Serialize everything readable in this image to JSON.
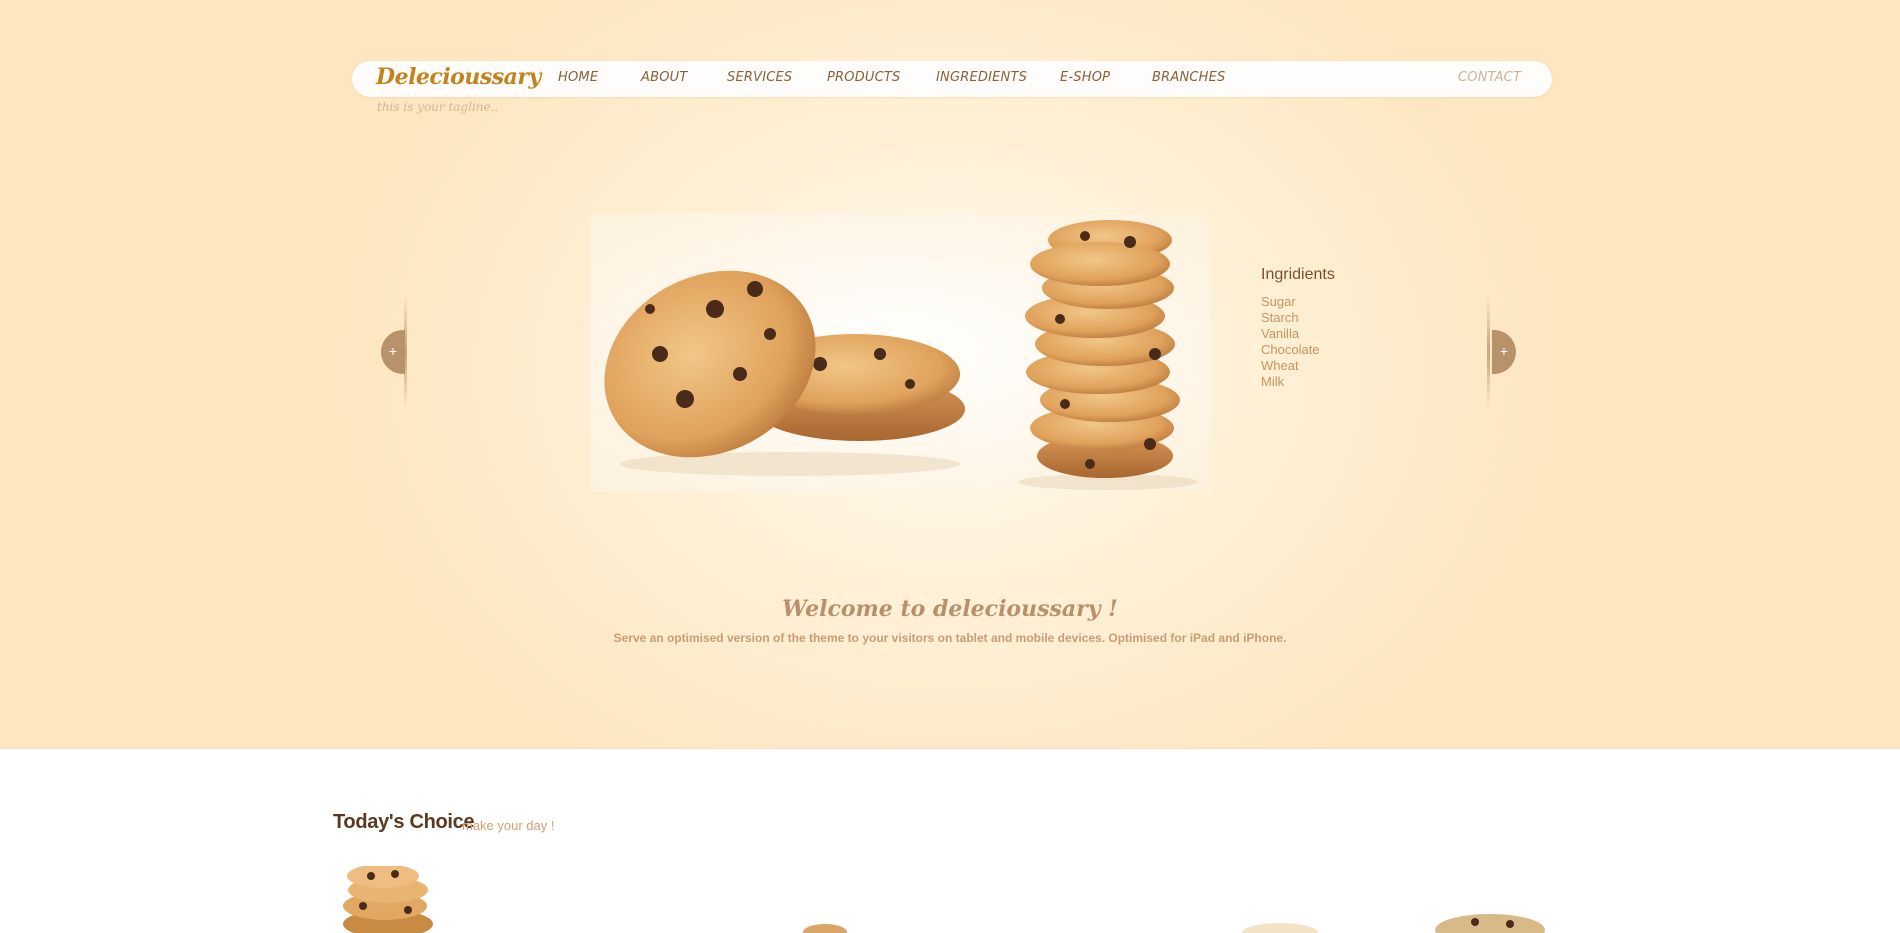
{
  "brand": {
    "name": "Delecioussary",
    "tagline": "this is your tagline.."
  },
  "nav": {
    "items": [
      "Home",
      "About",
      "Services",
      "Products",
      "Ingredients",
      "E-Shop",
      "Branches"
    ],
    "contact": "Contact"
  },
  "slider": {
    "image": "chocolate-chip-cookies-photo",
    "ingredients_title": "Ingridients",
    "ingredients": [
      "Sugar",
      "Starch",
      "Vanilla",
      "Chocolate",
      "Wheat",
      "Milk"
    ],
    "prev_symbol": "+",
    "next_symbol": "+"
  },
  "welcome": {
    "title": "Welcome to delecioussary !",
    "text": "Serve an optimised version of the theme to your visitors on tablet and mobile devices. Optimised for iPad and iPhone."
  },
  "todays_choice": {
    "title": "Today's Choice",
    "subtitle": "make your day !"
  },
  "colors": {
    "accent": "#c4821c",
    "nav_text": "#8a6136",
    "hero_background": "#fde6c0",
    "arrow": "#b8936a"
  }
}
